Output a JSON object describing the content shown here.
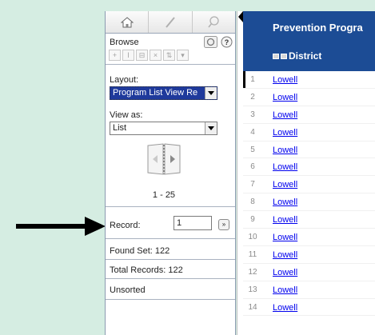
{
  "toolbar": {
    "tabs": [
      {
        "name": "home-icon"
      },
      {
        "name": "edit-icon"
      },
      {
        "name": "search-icon"
      }
    ]
  },
  "mode": {
    "label": "Browse",
    "icons": [
      "refresh-icon",
      "help-icon"
    ]
  },
  "layout": {
    "label": "Layout:",
    "selected": "Program List View Re"
  },
  "view_as": {
    "label": "View as:",
    "selected": "List"
  },
  "book": {
    "range": "1 - 25"
  },
  "record": {
    "label": "Record:",
    "value": "1",
    "go_label": "»"
  },
  "status": {
    "found_set": "Found Set: 122",
    "total_records": "Total Records: 122",
    "sort_state": "Unsorted"
  },
  "list_header": {
    "title": "Prevention Progra",
    "column": "District"
  },
  "rows": [
    {
      "num": "1",
      "district": "Lowell"
    },
    {
      "num": "2",
      "district": "Lowell"
    },
    {
      "num": "3",
      "district": "Lowell"
    },
    {
      "num": "4",
      "district": "Lowell"
    },
    {
      "num": "5",
      "district": "Lowell"
    },
    {
      "num": "6",
      "district": "Lowell"
    },
    {
      "num": "7",
      "district": "Lowell"
    },
    {
      "num": "8",
      "district": "Lowell"
    },
    {
      "num": "9",
      "district": "Lowell"
    },
    {
      "num": "10",
      "district": "Lowell"
    },
    {
      "num": "11",
      "district": "Lowell"
    },
    {
      "num": "12",
      "district": "Lowell"
    },
    {
      "num": "13",
      "district": "Lowell"
    },
    {
      "num": "14",
      "district": "Lowell"
    }
  ],
  "colors": {
    "background": "#d5ede2",
    "header_blue": "#1c4c95",
    "selection_blue": "#1f3a9c",
    "link": "#0000ee"
  }
}
